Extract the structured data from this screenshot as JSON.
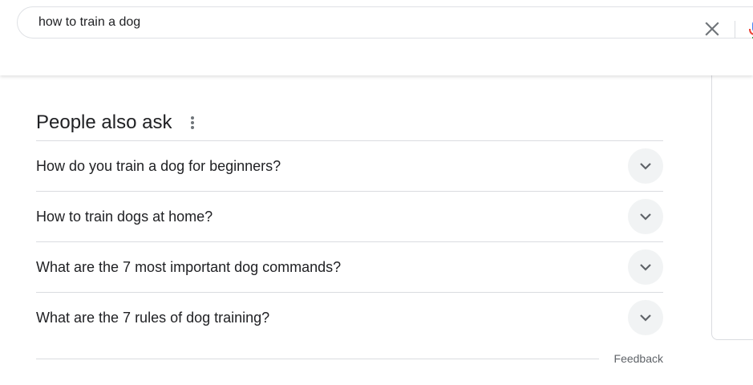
{
  "search": {
    "query": "how to train a dog"
  },
  "people_also_ask": {
    "title": "People also ask",
    "questions": [
      "How do you train a dog for beginners?",
      "How to train dogs at home?",
      "What are the 7 most important dog commands?",
      "What are the 7 rules of dog training?"
    ],
    "feedback_label": "Feedback"
  },
  "colors": {
    "text": "#202124",
    "divider": "#dadce0",
    "expand_button_bg": "#f1f3f4",
    "secondary_text": "#5f6368"
  },
  "icons": {
    "clear": "close-icon",
    "mic": "microphone-icon",
    "more": "more-vert-icon",
    "expand": "chevron-down-icon"
  }
}
